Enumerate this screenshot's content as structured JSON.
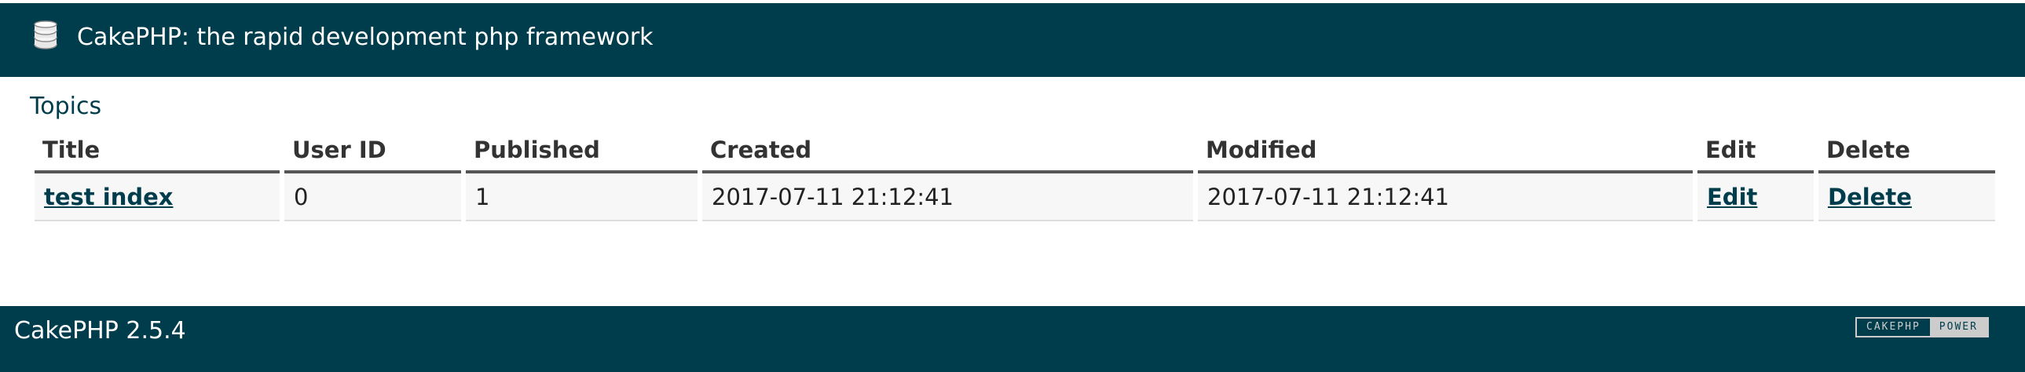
{
  "header": {
    "title": "CakePHP: the rapid development php framework",
    "logo_icon": "cake-stack-icon"
  },
  "main": {
    "heading": "Topics",
    "table": {
      "columns": [
        "Title",
        "User ID",
        "Published",
        "Created",
        "Modified",
        "Edit",
        "Delete"
      ],
      "rows": [
        {
          "title": "test index",
          "user_id": "0",
          "published": "1",
          "created": "2017-07-11 21:12:41",
          "modified": "2017-07-11 21:12:41",
          "edit": "Edit",
          "delete": "Delete"
        }
      ]
    }
  },
  "footer": {
    "version": "CakePHP 2.5.4",
    "badge_left": "CAKEPHP",
    "badge_right": "POWER"
  },
  "colors": {
    "brand": "#003d4c",
    "header_text": "#ffffff",
    "row_bg": "#f7f7f7"
  }
}
